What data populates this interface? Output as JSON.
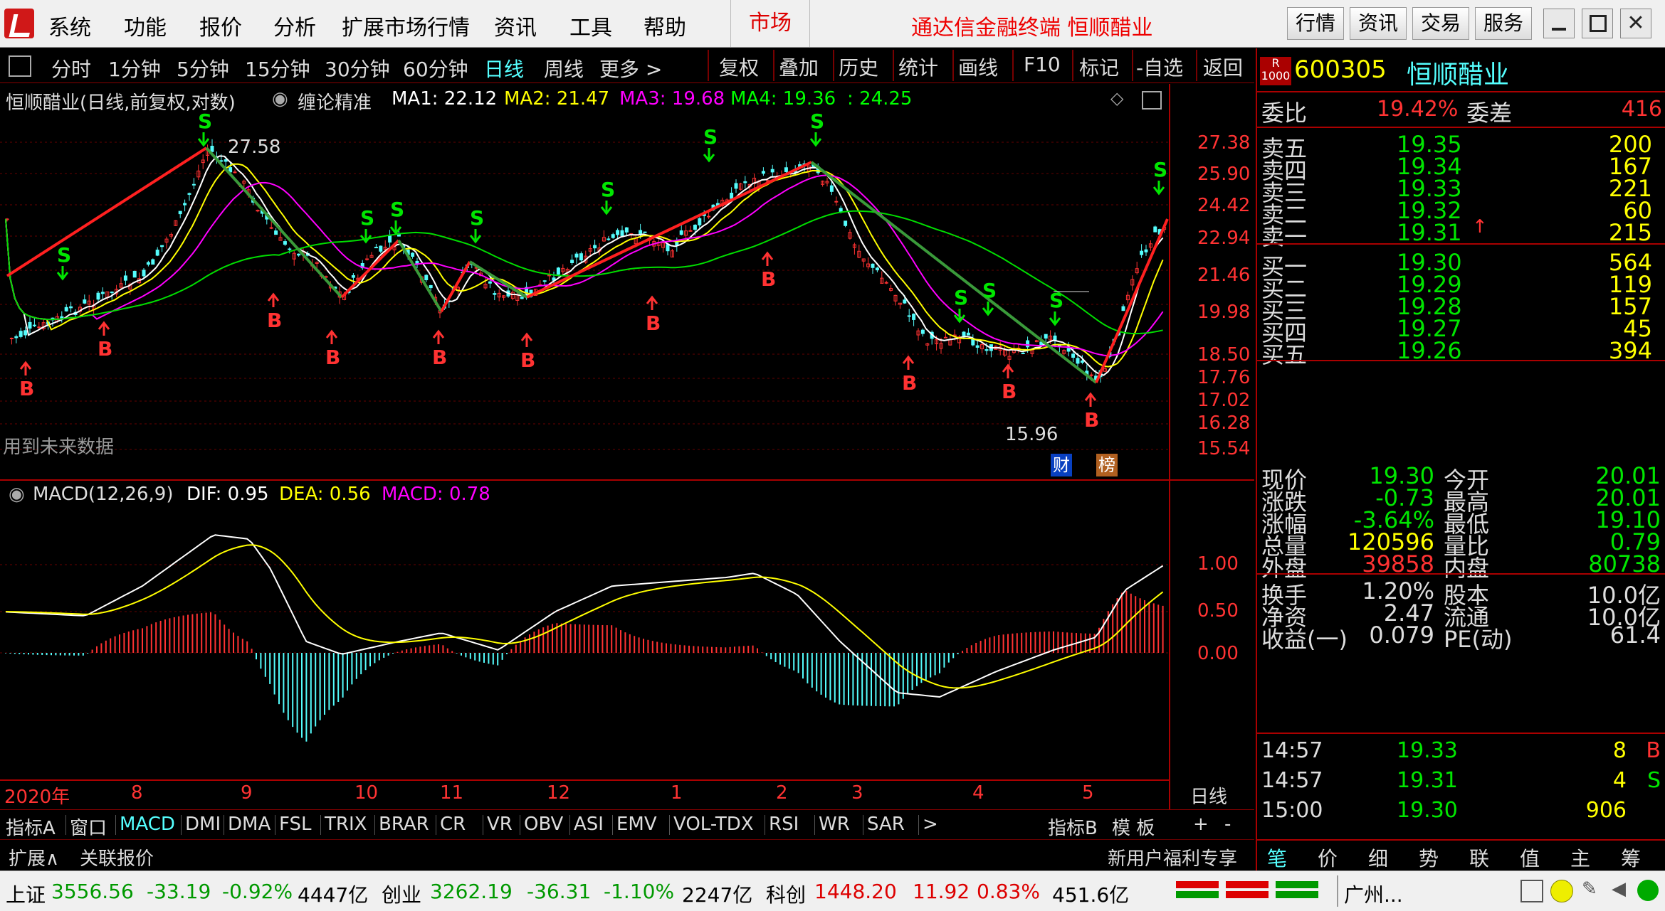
{
  "menu": {
    "items": [
      "系统",
      "功能",
      "报价",
      "分析",
      "扩展市场行情",
      "资讯",
      "工具",
      "帮助"
    ],
    "market": "市场",
    "app_title": "通达信金融终端 恒顺醋业",
    "right_buttons": [
      "行情",
      "资讯",
      "交易",
      "服务"
    ]
  },
  "periods": [
    "分时",
    "1分钟",
    "5分钟",
    "15分钟",
    "30分钟",
    "60分钟",
    "日线",
    "周线",
    "更多 >"
  ],
  "active_period": "日线",
  "tools": [
    "复权",
    "叠加",
    "历史",
    "统计",
    "画线",
    "F10",
    "标记",
    "-自选",
    "返回"
  ],
  "chart_header": {
    "title": "恒顺醋业(日线,前复权,对数)",
    "indicator": "缠论精准",
    "ma1": "MA1: 22.12",
    "ma2": "MA2: 21.47",
    "ma3": "MA3: 19.68",
    "ma4": "MA4: 19.36",
    "ma5": ": 24.25"
  },
  "chart_data": [
    {
      "type": "candlestick",
      "price_axis_ticks": [
        "27.38",
        "25.90",
        "24.42",
        "22.94",
        "21.46",
        "19.98",
        "18.50",
        "17.76",
        "17.02",
        "16.28",
        "15.54"
      ],
      "annotations": {
        "high": "27.58",
        "low": "15.96",
        "badges": [
          "财",
          "榜"
        ],
        "note": "用到未来数据"
      },
      "signals": {
        "buy": "B",
        "sell": "S"
      },
      "x_labels": [
        "2020年",
        "8",
        "9",
        "10",
        "11",
        "12",
        "1",
        "2",
        "3",
        "4",
        "5"
      ],
      "x_unit_label": "日线"
    },
    {
      "type": "bar",
      "title": "MACD(12,26,9)",
      "dif": "DIF: 0.95",
      "dea": "DEA: 0.56",
      "macd": "MACD: 0.78",
      "axis_ticks": [
        "1.00",
        "0.50",
        "0.00"
      ],
      "ylim": [
        -1.25,
        1.6
      ]
    }
  ],
  "bottom_tabs": [
    "指标A",
    "窗口",
    "MACD",
    "DMI",
    "DMA",
    "FSL",
    "TRIX",
    "BRAR",
    "CR",
    "VR",
    "OBV",
    "ASI",
    "EMV",
    "VOL-TDX",
    "RSI",
    "WR",
    "SAR",
    ">"
  ],
  "bottom_tabs_right": [
    "指标B",
    "模 板",
    "+",
    "-"
  ],
  "active_tab": "MACD",
  "bottom_row2": {
    "left": [
      "扩展∧",
      "关联报价"
    ],
    "right": "新用户福利专享"
  },
  "stock": {
    "badge": "R",
    "badge_sub": "1000",
    "code": "600305",
    "name": "恒顺醋业"
  },
  "committee": {
    "wb_label": "委比",
    "wb_value": "19.42%",
    "wc_label": "委差",
    "wc_value": "416"
  },
  "sell": [
    {
      "label": "卖五",
      "price": "19.35",
      "vol": "200"
    },
    {
      "label": "卖四",
      "price": "19.34",
      "vol": "167"
    },
    {
      "label": "卖三",
      "price": "19.33",
      "vol": "221"
    },
    {
      "label": "卖二",
      "price": "19.32",
      "vol": "60"
    },
    {
      "label": "卖一",
      "price": "19.31",
      "vol": "215"
    }
  ],
  "buy": [
    {
      "label": "买一",
      "price": "19.30",
      "vol": "564"
    },
    {
      "label": "买二",
      "price": "19.29",
      "vol": "119"
    },
    {
      "label": "买三",
      "price": "19.28",
      "vol": "157"
    },
    {
      "label": "买四",
      "price": "19.27",
      "vol": "45"
    },
    {
      "label": "买五",
      "price": "19.26",
      "vol": "394"
    }
  ],
  "quote": [
    {
      "l1": "现价",
      "v1": "19.30",
      "l2": "今开",
      "v2": "20.01"
    },
    {
      "l1": "涨跌",
      "v1": "-0.73",
      "l2": "最高",
      "v2": "20.01"
    },
    {
      "l1": "涨幅",
      "v1": "-3.64%",
      "l2": "最低",
      "v2": "19.10"
    },
    {
      "l1": "总量",
      "v1": "120596",
      "l2": "量比",
      "v2": "0.79"
    },
    {
      "l1": "外盘",
      "v1": "39858",
      "l2": "内盘",
      "v2": "80738"
    }
  ],
  "fundamentals": [
    {
      "l1": "换手",
      "v1": "1.20%",
      "l2": "股本",
      "v2": "10.0亿"
    },
    {
      "l1": "净资",
      "v1": "2.47",
      "l2": "流通",
      "v2": "10.0亿"
    },
    {
      "l1": "收益(一)",
      "v1": "0.079",
      "l2": "PE(动)",
      "v2": "61.4"
    }
  ],
  "ticks": [
    {
      "time": "14:57",
      "price": "19.33",
      "vol": "8",
      "flag": "B"
    },
    {
      "time": "14:57",
      "price": "19.31",
      "vol": "4",
      "flag": "S"
    },
    {
      "time": "15:00",
      "price": "19.30",
      "vol": "906",
      "flag": ""
    }
  ],
  "right_tabs": [
    "笔",
    "价",
    "细",
    "势",
    "联",
    "值",
    "主",
    "筹"
  ],
  "status": {
    "sh_label": "上证",
    "sh_val": "3556.56",
    "sh_chg": "-33.19",
    "sh_pct": "-0.92%",
    "sh_amt": "4447亿",
    "cy_label": "创业",
    "cy_val": "3262.19",
    "cy_chg": "-36.31",
    "cy_pct": "-1.10%",
    "cy_amt": "2247亿",
    "kc_label": "科创",
    "kc_val": "1448.20",
    "kc_chg": "11.92",
    "kc_pct": "0.83%",
    "kc_amt": "451.6亿",
    "city": "广州..."
  },
  "colors": {
    "up": "#ff3232",
    "down": "#00e600",
    "cyan": "#54fcfc",
    "yellow": "#ffff00",
    "magenta": "#ff00ff"
  }
}
